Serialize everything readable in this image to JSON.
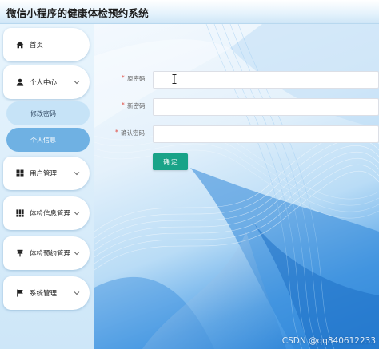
{
  "header": {
    "title": "微信小程序的健康体检预约系统"
  },
  "sidebar": {
    "items": [
      {
        "label": "首页",
        "icon": "home-icon"
      },
      {
        "label": "个人中心",
        "icon": "user-icon",
        "expanded": true,
        "children": [
          {
            "label": "修改密码"
          },
          {
            "label": "个人信息"
          }
        ]
      },
      {
        "label": "用户管理",
        "icon": "grid-icon"
      },
      {
        "label": "体检信息管理",
        "icon": "grid9-icon"
      },
      {
        "label": "体检预约管理",
        "icon": "pin-icon"
      },
      {
        "label": "系统管理",
        "icon": "flag-icon"
      }
    ]
  },
  "form": {
    "old_password": {
      "label": "原密码",
      "value": ""
    },
    "new_password": {
      "label": "新密码",
      "value": ""
    },
    "confirm_password": {
      "label": "确认密码",
      "value": ""
    },
    "required_mark": "*",
    "confirm_button": "确 定"
  },
  "watermark": "CSDN @qq840612233",
  "colors": {
    "accent": "#19a388",
    "selected_submenu": "#6fb1e3",
    "background_blue": "#2d86dc"
  }
}
